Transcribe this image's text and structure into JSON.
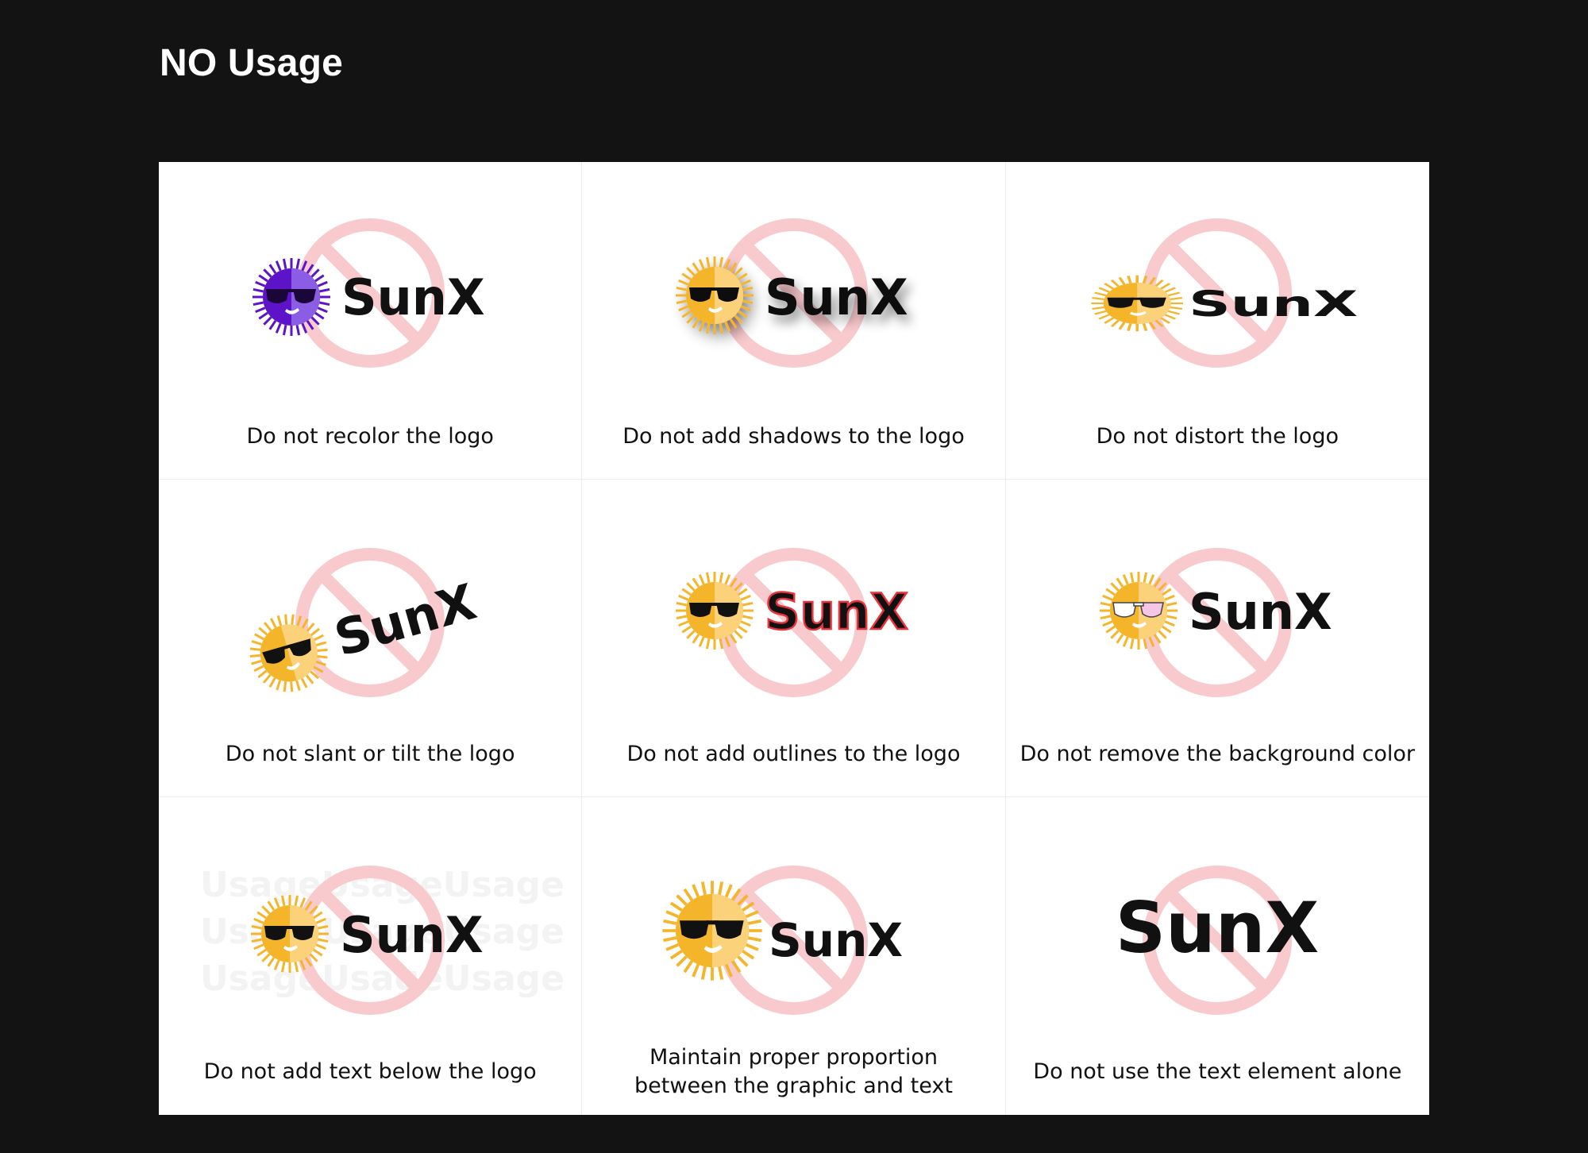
{
  "page": {
    "title": "NO Usage"
  },
  "brand": {
    "wordmark": "SunX",
    "colors": {
      "background": "#131313",
      "panel": "#ffffff",
      "sun": "#f5b52a",
      "sun_light": "#fbd27a",
      "glasses": "#111111",
      "wordmark": "#111111",
      "prohibit": "#f8c9cd",
      "recolor_purple": "#5d14c9",
      "outline_red": "#e8333b"
    }
  },
  "cells": [
    {
      "id": "recolor",
      "caption_lines": [
        "Do not recolor the logo"
      ]
    },
    {
      "id": "shadow",
      "caption_lines": [
        "Do not add shadows to the logo"
      ]
    },
    {
      "id": "distort",
      "caption_lines": [
        "Do not distort the logo"
      ]
    },
    {
      "id": "slant",
      "caption_lines": [
        "Do not slant or tilt the logo"
      ]
    },
    {
      "id": "outline",
      "caption_lines": [
        "Do not add outlines to the logo"
      ]
    },
    {
      "id": "background",
      "caption_lines": [
        "Do not remove the background color"
      ]
    },
    {
      "id": "text-below",
      "caption_lines": [
        "Do not add text below the logo"
      ],
      "watermark": "Usage"
    },
    {
      "id": "proportion",
      "caption_lines": [
        "Maintain proper proportion",
        "between the graphic and text"
      ]
    },
    {
      "id": "text-alone",
      "caption_lines": [
        "Do not use the text element alone"
      ]
    }
  ]
}
